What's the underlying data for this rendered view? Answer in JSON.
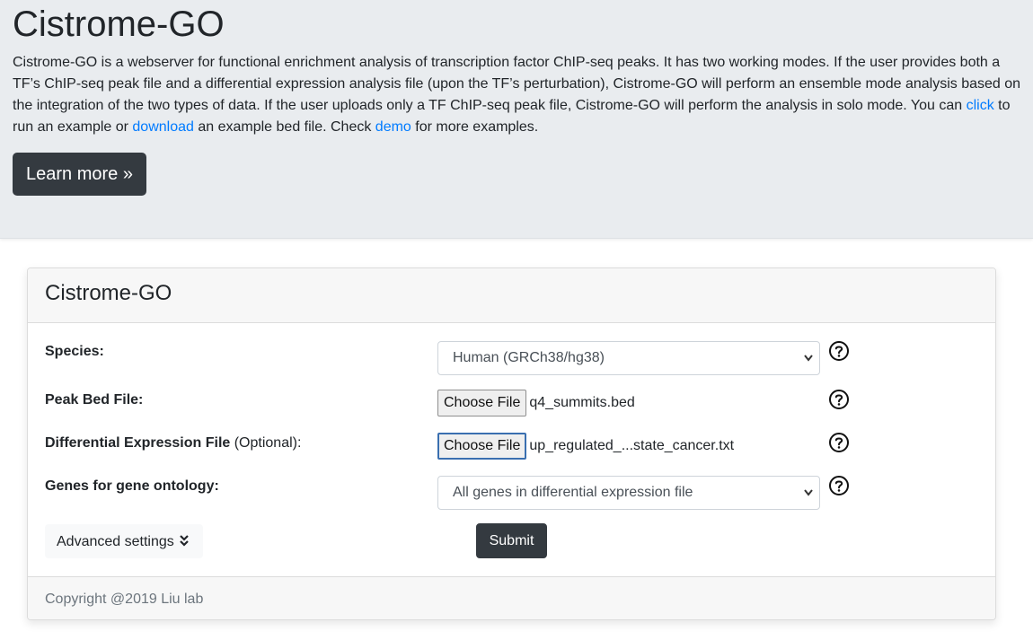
{
  "hero": {
    "title": "Cistrome-GO",
    "desc_part1": "Cistrome-GO is a webserver for functional enrichment analysis of transcription factor ChIP-seq peaks. It has two working modes. If the user provides both a TF’s ChIP-seq peak file and a differential expression analysis file (upon the TF’s perturbation), Cistrome-GO will perform an ensemble mode analysis based on the integration of the two types of data. If the user uploads only a TF ChIP-seq peak file, Cistrome-GO will perform the analysis in solo mode. You can ",
    "link_click": "click",
    "desc_part2": " to run an example or ",
    "link_download": "download",
    "desc_part3": " an example bed file. Check ",
    "link_demo": "demo",
    "desc_part4": " for more examples.",
    "learn_more": "Learn more »"
  },
  "card": {
    "title": "Cistrome-GO",
    "species_label": "Species:",
    "species_value": "Human (GRCh38/hg38)",
    "peak_label": "Peak Bed File:",
    "peak_button": "Choose File",
    "peak_file": "q4_summits.bed",
    "diff_label": "Differential Expression File",
    "diff_optional": " (Optional):",
    "diff_button": "Choose File",
    "diff_file": "up_regulated_...state_cancer.txt",
    "genes_label": "Genes for gene ontology:",
    "genes_value": "All genes in differential expression file",
    "advanced_label": "Advanced settings",
    "submit_label": "Submit",
    "footer": "Copyright @2019 Liu lab"
  },
  "icons": {
    "help": "question-circle-icon",
    "select_arrow": "chevron-down-icon",
    "advanced_toggle": "double-chevron-down-icon"
  },
  "colors": {
    "jumbotron_bg": "#e9ecef",
    "dark_button": "#343a40",
    "link": "#007bff",
    "card_header_bg": "#f7f7f7"
  }
}
